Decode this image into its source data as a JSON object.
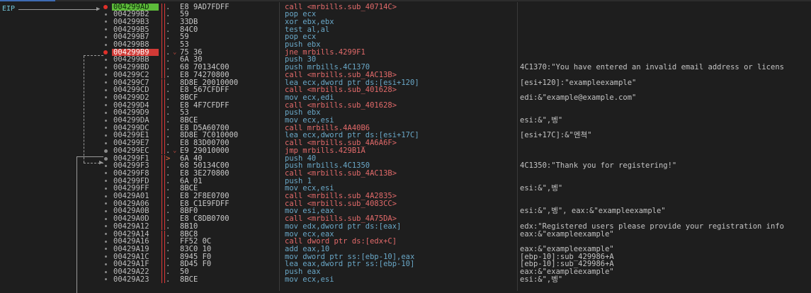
{
  "eip_label": "EIP",
  "rows": [
    {
      "addr": "004299AD",
      "mark": ".",
      "bytes": "E8 9AD7FDFF",
      "instr": "call <mrbills.sub_40714C>",
      "kind": "call",
      "comment": "",
      "addr_hl": "eip",
      "dot": "red"
    },
    {
      "addr": "004299B2",
      "mark": ".",
      "bytes": "59",
      "instr": "pop ecx",
      "kind": "normal",
      "comment": "",
      "addr_hl": "",
      "dot": ""
    },
    {
      "addr": "004299B3",
      "mark": ".",
      "bytes": "33DB",
      "instr": "xor ebx,ebx",
      "kind": "normal",
      "comment": "",
      "addr_hl": "",
      "dot": ""
    },
    {
      "addr": "004299B5",
      "mark": ".",
      "bytes": "84C0",
      "instr": "test al,al",
      "kind": "normal",
      "comment": "",
      "addr_hl": "",
      "dot": ""
    },
    {
      "addr": "004299B7",
      "mark": ".",
      "bytes": "59",
      "instr": "pop ecx",
      "kind": "normal",
      "comment": "",
      "addr_hl": "",
      "dot": ""
    },
    {
      "addr": "004299B8",
      "mark": ".",
      "bytes": "53",
      "instr": "push ebx",
      "kind": "normal",
      "comment": "",
      "addr_hl": "",
      "dot": ""
    },
    {
      "addr": "004299B9",
      "mark": ".",
      "bytes": "75 36",
      "instr": "jne mrbills.4299F1",
      "kind": "jmp",
      "comment": "",
      "addr_hl": "bp",
      "dot": "red",
      "jmpmark": "v"
    },
    {
      "addr": "004299BB",
      "mark": ".",
      "bytes": "6A 30",
      "instr": "push 30",
      "kind": "normal",
      "comment": "",
      "addr_hl": "",
      "dot": ""
    },
    {
      "addr": "004299BD",
      "mark": ".",
      "bytes": "68 70134C00",
      "instr": "push mrbills.4C1370",
      "kind": "normal",
      "comment": "4C1370:\"You have entered an invalid email address or licens",
      "addr_hl": "",
      "dot": ""
    },
    {
      "addr": "004299C2",
      "mark": ".",
      "bytes": "E8 74270800",
      "instr": "call <mrbills.sub_4AC13B>",
      "kind": "call",
      "comment": "",
      "addr_hl": "",
      "dot": ""
    },
    {
      "addr": "004299C7",
      "mark": ".",
      "bytes": "8D8E 20010000",
      "instr": "lea ecx,dword ptr ds:[esi+120]",
      "kind": "normal",
      "comment": "[esi+120]:\"exampleexample\"",
      "addr_hl": "",
      "dot": ""
    },
    {
      "addr": "004299CD",
      "mark": ".",
      "bytes": "E8 567CFDFF",
      "instr": "call <mrbills.sub_401628>",
      "kind": "call",
      "comment": "",
      "addr_hl": "",
      "dot": ""
    },
    {
      "addr": "004299D2",
      "mark": ".",
      "bytes": "8BCF",
      "instr": "mov ecx,edi",
      "kind": "normal",
      "comment": "edi:&\"example@example.com\"",
      "addr_hl": "",
      "dot": ""
    },
    {
      "addr": "004299D4",
      "mark": ".",
      "bytes": "E8 4F7CFDFF",
      "instr": "call <mrbills.sub_401628>",
      "kind": "call",
      "comment": "",
      "addr_hl": "",
      "dot": ""
    },
    {
      "addr": "004299D9",
      "mark": ".",
      "bytes": "53",
      "instr": "push ebx",
      "kind": "normal",
      "comment": "",
      "addr_hl": "",
      "dot": ""
    },
    {
      "addr": "004299DA",
      "mark": ".",
      "bytes": "8BCE",
      "instr": "mov ecx,esi",
      "kind": "normal",
      "comment": "esi:&\",벵\"",
      "addr_hl": "",
      "dot": ""
    },
    {
      "addr": "004299DC",
      "mark": ".",
      "bytes": "E8 D5A60700",
      "instr": "call mrbills.4A40B6",
      "kind": "call",
      "comment": "",
      "addr_hl": "",
      "dot": ""
    },
    {
      "addr": "004299E1",
      "mark": ".",
      "bytes": "8D8E 7C010000",
      "instr": "lea ecx,dword ptr ds:[esi+17C]",
      "kind": "normal",
      "comment": "[esi+17C]:&\"멘쳑\"",
      "addr_hl": "",
      "dot": ""
    },
    {
      "addr": "004299E7",
      "mark": ".",
      "bytes": "E8 83D00700",
      "instr": "call <mrbills.sub_4A6A6F>",
      "kind": "call",
      "comment": "",
      "addr_hl": "",
      "dot": ""
    },
    {
      "addr": "004299EC",
      "mark": ".",
      "bytes": "E9 29010000",
      "instr": "jmp mrbills.429B1A",
      "kind": "jmp",
      "comment": "",
      "addr_hl": "",
      "dot": "grey",
      "jmpmark": "v"
    },
    {
      "addr": "004299F1",
      "mark": ">",
      "bytes": "6A 40",
      "instr": "push 40",
      "kind": "normal",
      "comment": "",
      "addr_hl": "",
      "dot": "grey",
      "gt": true
    },
    {
      "addr": "004299F3",
      "mark": ".",
      "bytes": "68 50134C00",
      "instr": "push mrbills.4C1350",
      "kind": "normal",
      "comment": "4C1350:\"Thank you for registering!\"",
      "addr_hl": "",
      "dot": ""
    },
    {
      "addr": "004299F8",
      "mark": ".",
      "bytes": "E8 3E270800",
      "instr": "call <mrbills.sub_4AC13B>",
      "kind": "call",
      "comment": "",
      "addr_hl": "",
      "dot": ""
    },
    {
      "addr": "004299FD",
      "mark": ".",
      "bytes": "6A 01",
      "instr": "push 1",
      "kind": "normal",
      "comment": "",
      "addr_hl": "",
      "dot": ""
    },
    {
      "addr": "004299FF",
      "mark": ".",
      "bytes": "8BCE",
      "instr": "mov ecx,esi",
      "kind": "normal",
      "comment": "esi:&\",벵\"",
      "addr_hl": "",
      "dot": ""
    },
    {
      "addr": "00429A01",
      "mark": ".",
      "bytes": "E8 2F8E0700",
      "instr": "call <mrbills.sub_4A2835>",
      "kind": "call",
      "comment": "",
      "addr_hl": "",
      "dot": ""
    },
    {
      "addr": "00429A06",
      "mark": ".",
      "bytes": "E8 C1E9FDFF",
      "instr": "call <mrbills.sub_4083CC>",
      "kind": "call",
      "comment": "",
      "addr_hl": "",
      "dot": ""
    },
    {
      "addr": "00429A0B",
      "mark": ".",
      "bytes": "8BF0",
      "instr": "mov esi,eax",
      "kind": "normal",
      "comment": "esi:&\",벵\", eax:&\"exampleexample\"",
      "addr_hl": "",
      "dot": ""
    },
    {
      "addr": "00429A0D",
      "mark": ".",
      "bytes": "E8 C8DB0700",
      "instr": "call <mrbills.sub_4A75DA>",
      "kind": "call",
      "comment": "",
      "addr_hl": "",
      "dot": ""
    },
    {
      "addr": "00429A12",
      "mark": ".",
      "bytes": "8B10",
      "instr": "mov edx,dword ptr ds:[eax]",
      "kind": "normal",
      "comment": "edx:\"Registered users please provide your registration info",
      "addr_hl": "",
      "dot": ""
    },
    {
      "addr": "00429A14",
      "mark": ".",
      "bytes": "8BC8",
      "instr": "mov ecx,eax",
      "kind": "normal",
      "comment": "eax:&\"exampleexample\"",
      "addr_hl": "",
      "dot": ""
    },
    {
      "addr": "00429A16",
      "mark": ".",
      "bytes": "FF52 0C",
      "instr": "call dword ptr ds:[edx+C]",
      "kind": "call",
      "comment": "",
      "addr_hl": "",
      "dot": ""
    },
    {
      "addr": "00429A19",
      "mark": ".",
      "bytes": "83C0 10",
      "instr": "add eax,10",
      "kind": "normal",
      "comment": "eax:&\"exampleexample\"",
      "addr_hl": "",
      "dot": ""
    },
    {
      "addr": "00429A1C",
      "mark": ".",
      "bytes": "8945 F0",
      "instr": "mov dword ptr ss:[ebp-10],eax",
      "kind": "normal",
      "comment": "[ebp-10]:sub_429986+A",
      "addr_hl": "",
      "dot": ""
    },
    {
      "addr": "00429A1F",
      "mark": ".",
      "bytes": "8D45 F0",
      "instr": "lea eax,dword ptr ss:[ebp-10]",
      "kind": "normal",
      "comment": "[ebp-10]:sub_429986+A",
      "addr_hl": "",
      "dot": ""
    },
    {
      "addr": "00429A22",
      "mark": ".",
      "bytes": "50",
      "instr": "push eax",
      "kind": "normal",
      "comment": "eax:&\"exampleexample\"",
      "addr_hl": "",
      "dot": ""
    },
    {
      "addr": "00429A23",
      "mark": ".",
      "bytes": "8BCE",
      "instr": "mov ecx,esi",
      "kind": "normal",
      "comment": "esi:&\",벵\"",
      "addr_hl": "",
      "dot": ""
    }
  ]
}
